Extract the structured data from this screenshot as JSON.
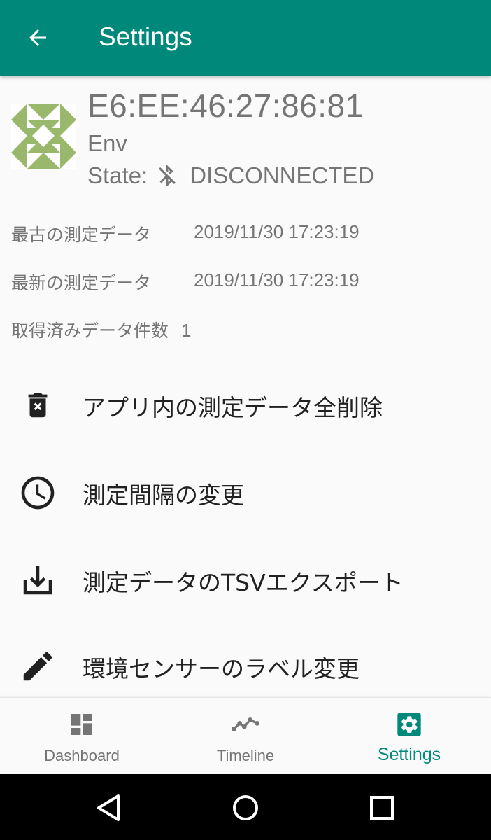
{
  "appbar": {
    "title": "Settings",
    "back_icon": "arrow-left-icon",
    "color": "#00897b"
  },
  "device": {
    "mac": "E6:EE:46:27:86:81",
    "name": "Env",
    "state_label": "State:",
    "state_value": "DISCONNECTED",
    "identicon_color": "#9ab86b"
  },
  "info": [
    {
      "label": "最古の測定データ",
      "value": "2019/11/30 17:23:19"
    },
    {
      "label": "最新の測定データ",
      "value": "2019/11/30 17:23:19"
    },
    {
      "label": "取得済みデータ件数",
      "value": "1"
    }
  ],
  "actions": [
    {
      "label": "アプリ内の測定データ全削除",
      "icon": "trash-icon"
    },
    {
      "label": "測定間隔の変更",
      "icon": "clock-icon"
    },
    {
      "label": "測定データのTSVエクスポート",
      "icon": "download-icon"
    },
    {
      "label": "環境センサーのラベル変更",
      "icon": "pencil-icon"
    }
  ],
  "bottom_nav": [
    {
      "label": "Dashboard",
      "icon": "dashboard-icon",
      "active": false
    },
    {
      "label": "Timeline",
      "icon": "timeline-icon",
      "active": false
    },
    {
      "label": "Settings",
      "icon": "gear-icon",
      "active": true
    }
  ],
  "system_nav": {
    "back": "back-triangle-icon",
    "home": "home-circle-icon",
    "recents": "recents-square-icon"
  }
}
